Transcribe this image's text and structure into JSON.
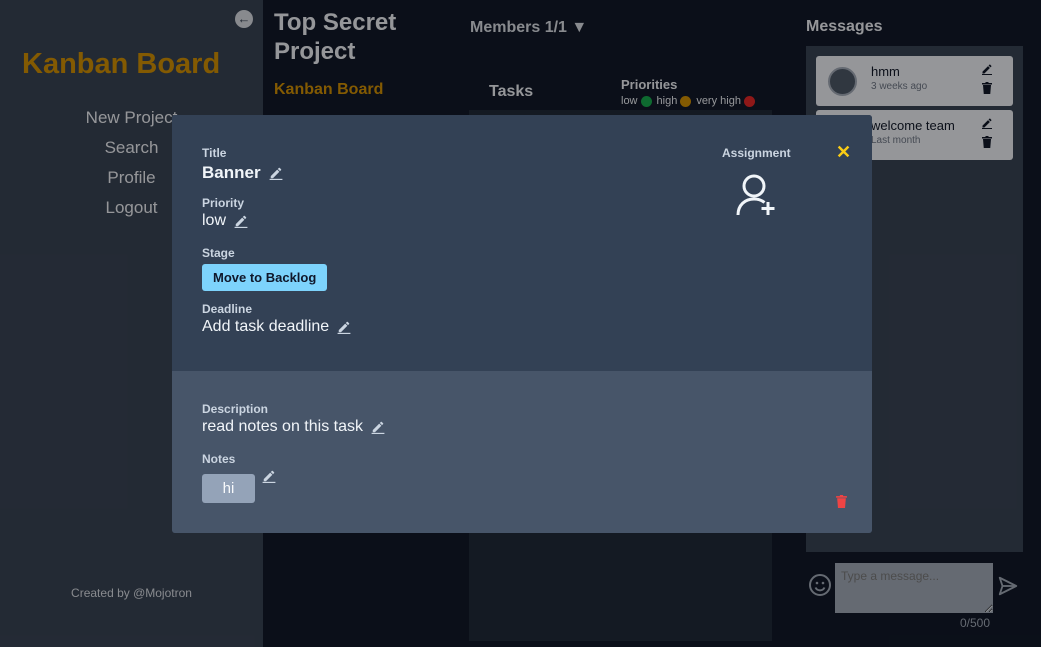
{
  "sidebar": {
    "brand": "Kanban Board",
    "nav": [
      "New Project",
      "Search",
      "Profile",
      "Logout"
    ],
    "credit": "Created by @Mojotron"
  },
  "project": {
    "title": "Top Secret Project",
    "subtitle": "Kanban Board",
    "members": "Members 1/1 ▼",
    "tasks_heading": "Tasks",
    "priorities": {
      "title": "Priorities",
      "legend": [
        {
          "label": "low",
          "color": "#16a34a"
        },
        {
          "label": "high",
          "color": "#ca8a04"
        },
        {
          "label": "very high",
          "color": "#dc2626"
        }
      ]
    }
  },
  "messages": {
    "title": "Messages",
    "items": [
      {
        "text": "hmm",
        "time": "3 weeks ago"
      },
      {
        "text": "welcome team",
        "time": "Last month"
      }
    ],
    "input_placeholder": "Type a message...",
    "char_count": "0/500"
  },
  "modal": {
    "title_label": "Title",
    "title_value": "Banner",
    "priority_label": "Priority",
    "priority_value": "low",
    "stage_label": "Stage",
    "stage_button": "Move to Backlog",
    "deadline_label": "Deadline",
    "deadline_value": "Add task deadline",
    "assignment_label": "Assignment",
    "close": "✕",
    "description_label": "Description",
    "description_value": "read notes on this task",
    "notes_label": "Notes",
    "notes": [
      "hi"
    ]
  },
  "colors": {
    "accent_gold": "#ca8a04",
    "close_yellow": "#facc15",
    "stage_button": "#7dd3fc",
    "delete_red": "#ef4444"
  }
}
